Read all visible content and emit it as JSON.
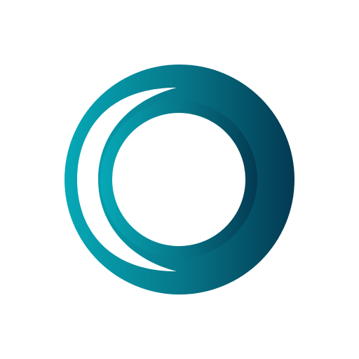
{
  "logo": {
    "icon": "ring-logo-icon",
    "colors": {
      "background": "#ffffff",
      "gradient_start": "#06a9b7",
      "gradient_mid": "#06788a",
      "gradient_end": "#033a52",
      "cutout": "#ffffff"
    }
  }
}
